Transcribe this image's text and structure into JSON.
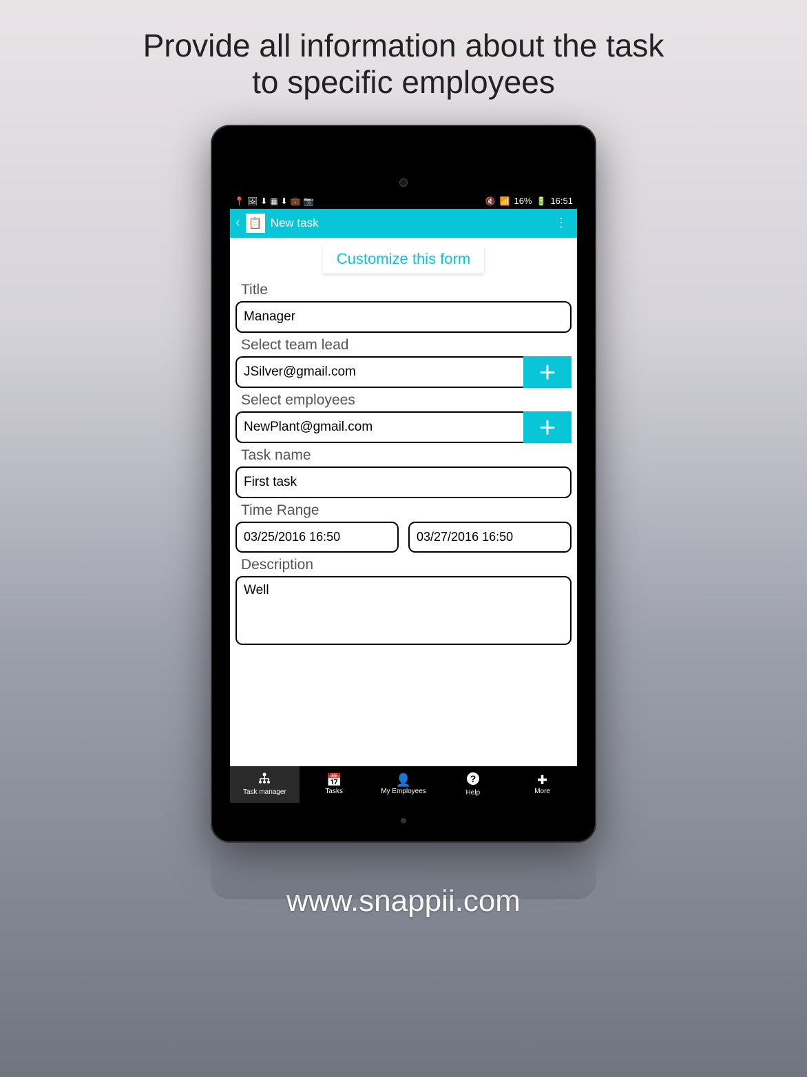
{
  "promo": {
    "line1": "Provide all information about the task",
    "line2": "to specific employees"
  },
  "statusbar": {
    "battery": "16%",
    "time": "16:51"
  },
  "header": {
    "title": "New task"
  },
  "form": {
    "customize_label": "Customize this form",
    "title_label": "Title",
    "title_value": "Manager",
    "teamlead_label": "Select team lead",
    "teamlead_value": "JSilver@gmail.com",
    "employees_label": "Select employees",
    "employees_value": "NewPlant@gmail.com",
    "taskname_label": "Task name",
    "taskname_value": "First task",
    "timerange_label": "Time Range",
    "time_start": "03/25/2016 16:50",
    "time_end": "03/27/2016 16:50",
    "description_label": "Description",
    "description_value": "Well"
  },
  "nav": {
    "item0": "Task manager",
    "item1": "Tasks",
    "item2": "My Employees",
    "item3": "Help",
    "item4": "More"
  },
  "footer": {
    "url": "www.snappii.com"
  },
  "colors": {
    "accent": "#09c5d8"
  }
}
